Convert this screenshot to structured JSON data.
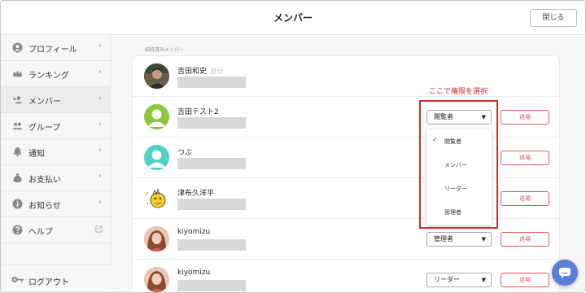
{
  "header": {
    "title": "メンバー",
    "close_label": "閉じる"
  },
  "sidebar": {
    "items": [
      {
        "label": "プロフィール",
        "icon": "person-circle-icon"
      },
      {
        "label": "ランキング",
        "icon": "crown-icon"
      },
      {
        "label": "メンバー",
        "icon": "add-person-icon"
      },
      {
        "label": "グループ",
        "icon": "group-icon"
      },
      {
        "label": "通知",
        "icon": "bell-icon"
      },
      {
        "label": "お支払い",
        "icon": "money-bag-icon"
      },
      {
        "label": "お知らせ",
        "icon": "info-icon"
      },
      {
        "label": "ヘルプ",
        "icon": "question-icon"
      }
    ],
    "logout_label": "ログアウト"
  },
  "main": {
    "section_label": "招待済みメンバー",
    "self_tag": "自分",
    "leave_label": "退場",
    "members": [
      {
        "name": "吉田和史",
        "role": "",
        "is_self": true
      },
      {
        "name": "吉田テスト2",
        "role": "閲覧者"
      },
      {
        "name": "つぶ",
        "role": ""
      },
      {
        "name": "津布久洋平",
        "role": ""
      },
      {
        "name": "kiyomizu",
        "role": "管理者"
      },
      {
        "name": "kiyomizu",
        "role": "リーダー"
      }
    ]
  },
  "dropdown": {
    "options": [
      "閲覧者",
      "メンバー",
      "リーダー",
      "管理者"
    ],
    "selected": "閲覧者"
  },
  "annotation": {
    "text": "ここで権限を選択"
  },
  "colors": {
    "accent_red": "#d12a2a",
    "leave_red": "#e15a5a",
    "chat_blue": "#5b7fd6"
  }
}
